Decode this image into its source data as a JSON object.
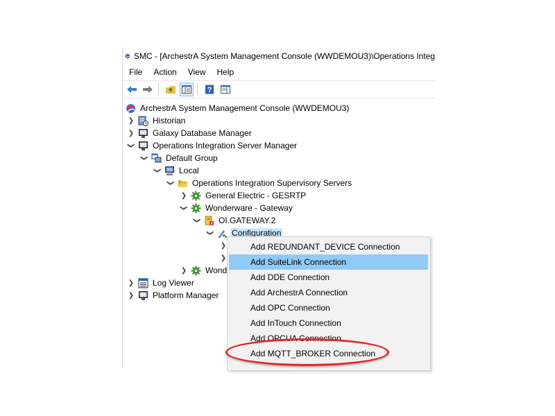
{
  "window": {
    "title": "SMC - [ArchestrA System Management Console (WWDEMOU3)\\Operations Integ"
  },
  "menu": [
    "File",
    "Action",
    "View",
    "Help"
  ],
  "toolbar": [
    {
      "icon": "back-arrow-icon"
    },
    {
      "icon": "forward-arrow-icon"
    },
    {
      "icon": "up-folder-icon"
    },
    {
      "icon": "show-hide-console-tree-icon"
    },
    {
      "icon": "help-icon"
    },
    {
      "icon": "show-hide-action-pane-icon"
    }
  ],
  "tree": {
    "root": "ArchestrA System Management Console (WWDEMOU3)",
    "historian": "Historian",
    "galaxy_db": "Galaxy Database Manager",
    "ois_manager": "Operations Integration Server Manager",
    "default_group": "Default Group",
    "local": "Local",
    "supervisory_servers": "Operations Integration Supervisory Servers",
    "ge": "General Electric - GESRTP",
    "wonderware_gateway": "Wonderware - Gateway",
    "oi_gateway": "OI.GATEWAY.2",
    "configuration": "Configuration",
    "wond_truncated": "Wond",
    "log_viewer": "Log Viewer",
    "platform_manager": "Platform Manager"
  },
  "context_menu": {
    "items": [
      "Add REDUNDANT_DEVICE Connection",
      "Add SuiteLink Connection",
      "Add DDE Connection",
      "Add ArchestrA Connection",
      "Add OPC Connection",
      "Add InTouch Connection",
      "Add OPCUA Connection",
      "Add MQTT_BROKER Connection"
    ],
    "highlighted_index": 1,
    "circled_item": "Add MQTT_BROKER Connection"
  },
  "colors": {
    "highlight": "#91c9f7",
    "selection": "#cce8ff",
    "annotation_oval": "#e3262b",
    "menu_bg": "#f2f2f2"
  }
}
